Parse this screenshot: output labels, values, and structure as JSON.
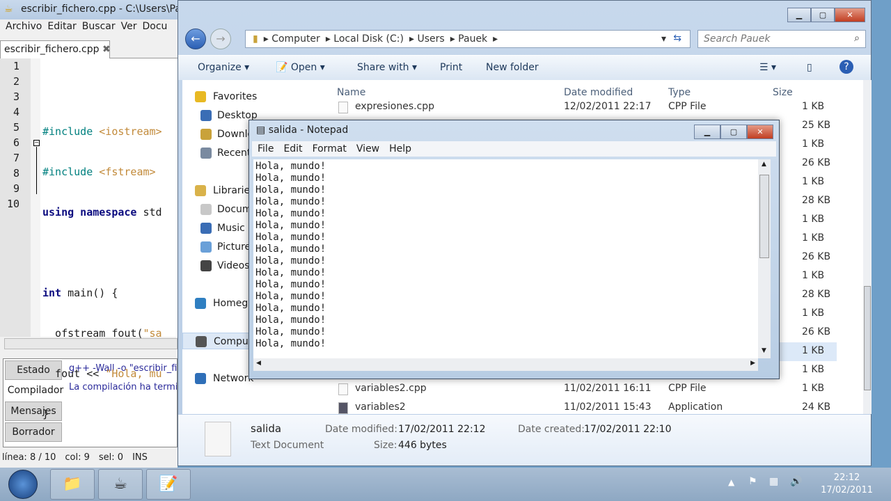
{
  "geany": {
    "title": "escribir_fichero.cpp - C:\\Users\\Pau",
    "menu": [
      "Archivo",
      "Editar",
      "Buscar",
      "Ver",
      "Docu"
    ],
    "tab": "escribir_fichero.cpp",
    "line_numbers": [
      "1",
      "2",
      "3",
      "4",
      "5",
      "6",
      "7",
      "8",
      "9",
      "10"
    ],
    "code": {
      "l2a": "#include ",
      "l2b": "<iostream>",
      "l3a": "#include ",
      "l3b": "<fstream>",
      "l4a": "using namespace",
      "l4b": " std",
      "l6a": "int",
      "l6b": " main() {",
      "l7a": "  ofstream fout(",
      "l7b": "\"sa",
      "l8a": "  fout << ",
      "l8b": "\"Hola, mu",
      "l9": "}"
    },
    "message_tabs": [
      "Estado",
      "Compilador",
      "Mensajes",
      "Borrador"
    ],
    "messages": [
      "g++ -Wall -o \"escribir_fi",
      "La compilación ha termi"
    ],
    "status": {
      "line": "línea: 8 / 10",
      "col": "col: 9",
      "sel": "sel: 0",
      "mode": "INS"
    }
  },
  "explorer": {
    "breadcrumb": [
      "Computer",
      "Local Disk (C:)",
      "Users",
      "Pauek"
    ],
    "search_placeholder": "Search Pauek",
    "toolbar": {
      "organize": "Organize",
      "open": "Open",
      "share": "Share with",
      "print": "Print",
      "new_folder": "New folder"
    },
    "nav": [
      "Favorites",
      "Desktop",
      "Downloads",
      "Recent Places",
      "Libraries",
      "Documents",
      "Music",
      "Pictures",
      "Videos",
      "Homegroup",
      "Computer",
      "Network"
    ],
    "columns": [
      "Name",
      "Date modified",
      "Type",
      "Size"
    ],
    "rows": [
      {
        "name": "expresiones.cpp",
        "date": "12/02/2011 22:17",
        "type": "CPP File",
        "size": "1 KB"
      },
      {
        "size": "25 KB"
      },
      {
        "size": "1 KB"
      },
      {
        "size": "26 KB"
      },
      {
        "size": "1 KB"
      },
      {
        "size": "28 KB"
      },
      {
        "size": "1 KB"
      },
      {
        "size": "1 KB"
      },
      {
        "size": "26 KB"
      },
      {
        "size": "1 KB"
      },
      {
        "size": "28 KB"
      },
      {
        "size": "1 KB"
      },
      {
        "size": "26 KB"
      },
      {
        "size": "1 KB",
        "selected": true
      },
      {
        "size": "1 KB"
      },
      {
        "name": "variables2.cpp",
        "date": "11/02/2011 16:11",
        "type": "CPP File",
        "size": "1 KB"
      },
      {
        "name": "variables2",
        "date": "11/02/2011 15:43",
        "type": "Application",
        "size": "24 KB"
      }
    ],
    "details": {
      "name": "salida",
      "kind": "Text Document",
      "modified_label": "Date modified:",
      "modified": "17/02/2011 22:12",
      "created_label": "Date created:",
      "created": "17/02/2011 22:10",
      "size_label": "Size:",
      "size": "446 bytes"
    }
  },
  "notepad": {
    "title": "salida - Notepad",
    "menu": [
      "File",
      "Edit",
      "Format",
      "View",
      "Help"
    ],
    "lines": [
      "Hola, mundo!",
      "Hola, mundo!",
      "Hola, mundo!",
      "Hola, mundo!",
      "Hola, mundo!",
      "Hola, mundo!",
      "Hola, mundo!",
      "Hola, mundo!",
      "Hola, mundo!",
      "Hola, mundo!",
      "Hola, mundo!",
      "Hola, mundo!",
      "Hola, mundo!",
      "Hola, mundo!",
      "Hola, mundo!",
      "Hola, mundo!"
    ]
  },
  "taskbar": {
    "time": "22:12",
    "date": "17/02/2011"
  }
}
